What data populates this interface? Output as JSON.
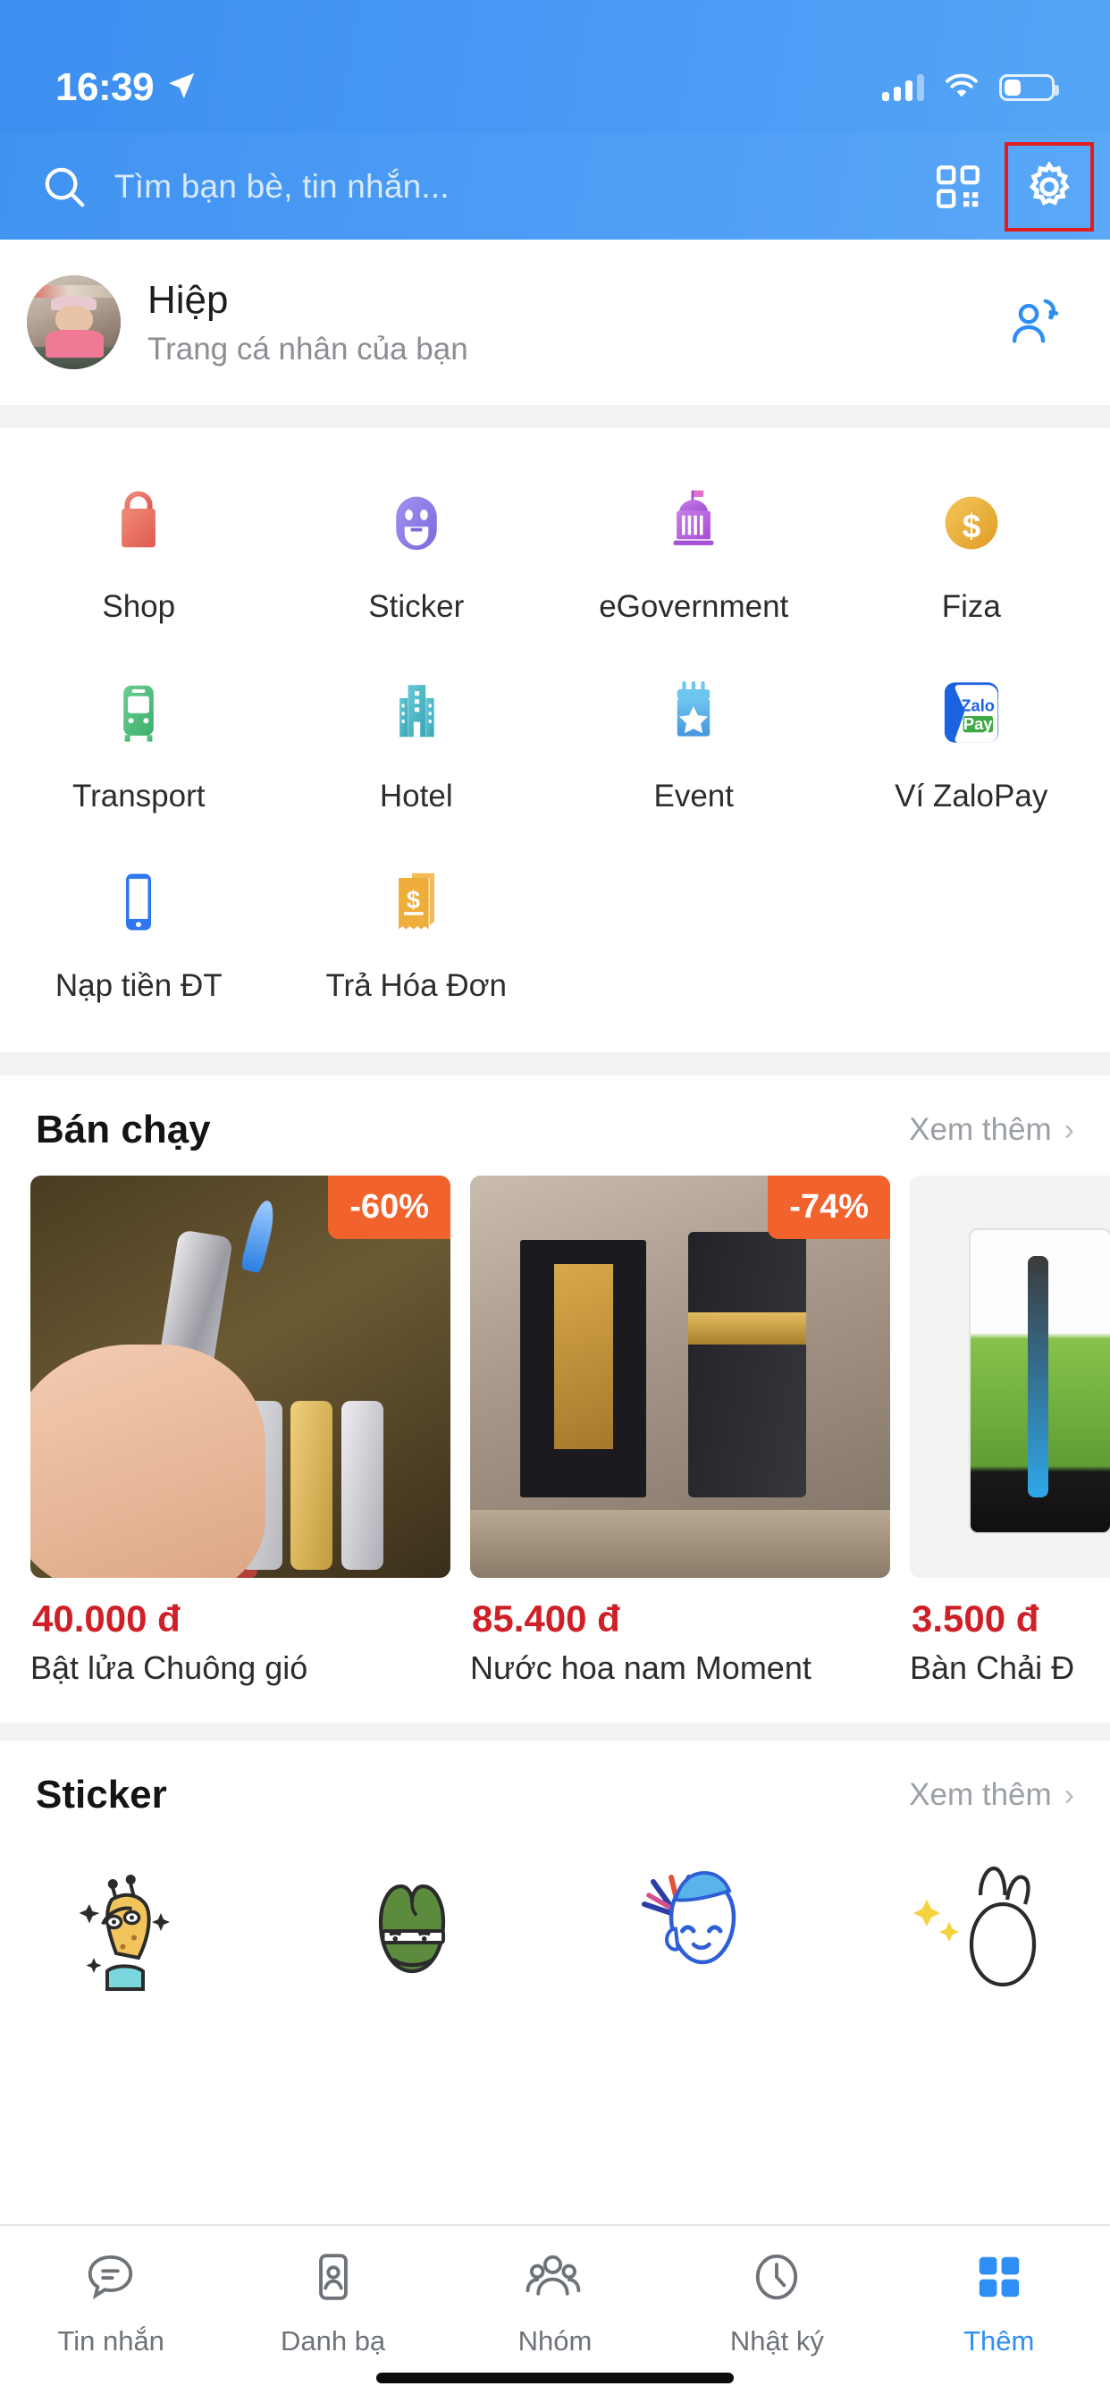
{
  "status_bar": {
    "time": "16:39",
    "location_icon": "location-arrow-icon",
    "signal_icon": "cellular-signal-icon",
    "wifi_icon": "wifi-icon",
    "battery_icon": "battery-icon",
    "battery_level_percent": 36
  },
  "search": {
    "placeholder": "Tìm bạn bè, tin nhắn...",
    "value": "",
    "search_icon": "search-icon",
    "qr_icon": "qr-code-icon",
    "settings_icon": "gear-icon",
    "highlight_color": "#e01c1c"
  },
  "profile": {
    "name": "Hiệp",
    "subtitle": "Trang cá nhân của bạn",
    "avatar_icon": "avatar",
    "switch_account_icon": "switch-account-icon"
  },
  "shortcuts": {
    "rows": [
      [
        {
          "label": "Shop",
          "icon": "shop-bag-icon",
          "color": "#e8716a"
        },
        {
          "label": "Sticker",
          "icon": "sticker-smiley-icon",
          "color": "#8b7ae8"
        },
        {
          "label": "eGovernment",
          "icon": "government-building-icon",
          "color": "#b96de0"
        },
        {
          "label": "Fiza",
          "icon": "coin-dollar-icon",
          "color": "#edb13c"
        }
      ],
      [
        {
          "label": "Transport",
          "icon": "bus-icon",
          "color": "#4fbd7e"
        },
        {
          "label": "Hotel",
          "icon": "hotel-building-icon",
          "color": "#4bb7c4"
        },
        {
          "label": "Event",
          "icon": "calendar-star-icon",
          "color": "#51a9ea"
        },
        {
          "label": "Ví ZaloPay",
          "icon": "zalopay-logo-icon",
          "color": "#1b62e0"
        }
      ],
      [
        {
          "label": "Nạp tiền ĐT",
          "icon": "mobile-phone-icon",
          "color": "#2f76ef"
        },
        {
          "label": "Trả Hóa Đơn",
          "icon": "bill-receipt-icon",
          "color": "#efad3c"
        }
      ]
    ]
  },
  "best_selling": {
    "title": "Bán chạy",
    "more_label": "Xem thêm",
    "chevron_icon": "chevron-right-icon",
    "products": [
      {
        "badge": "-60%",
        "price": "40.000 đ",
        "name": "Bật lửa Chuông gió",
        "image": "lighter-photo"
      },
      {
        "badge": "-74%",
        "price": "85.400 đ",
        "name": "Nước hoa nam Moment",
        "image": "perfume-photo"
      },
      {
        "badge": "",
        "price": "3.500 đ",
        "name": "Bàn Chải Đ",
        "image": "toothbrush-photo"
      }
    ]
  },
  "sticker_section": {
    "title": "Sticker",
    "more_label": "Xem thêm",
    "chevron_icon": "chevron-right-icon",
    "items": [
      {
        "icon": "giraffe-sticker"
      },
      {
        "icon": "frog-sticker"
      },
      {
        "icon": "blue-cap-blob-sticker"
      },
      {
        "icon": "rabbit-sticker"
      }
    ]
  },
  "tabbar": {
    "active_color": "#2f8ef4",
    "inactive_color": "#6e7379",
    "tabs": [
      {
        "label": "Tin nhắn",
        "icon": "chat-bubble-icon",
        "active": false
      },
      {
        "label": "Danh bạ",
        "icon": "contact-card-icon",
        "active": false
      },
      {
        "label": "Nhóm",
        "icon": "group-people-icon",
        "active": false
      },
      {
        "label": "Nhật ký",
        "icon": "clock-icon",
        "active": false
      },
      {
        "label": "Thêm",
        "icon": "grid-squares-icon",
        "active": true
      }
    ]
  }
}
